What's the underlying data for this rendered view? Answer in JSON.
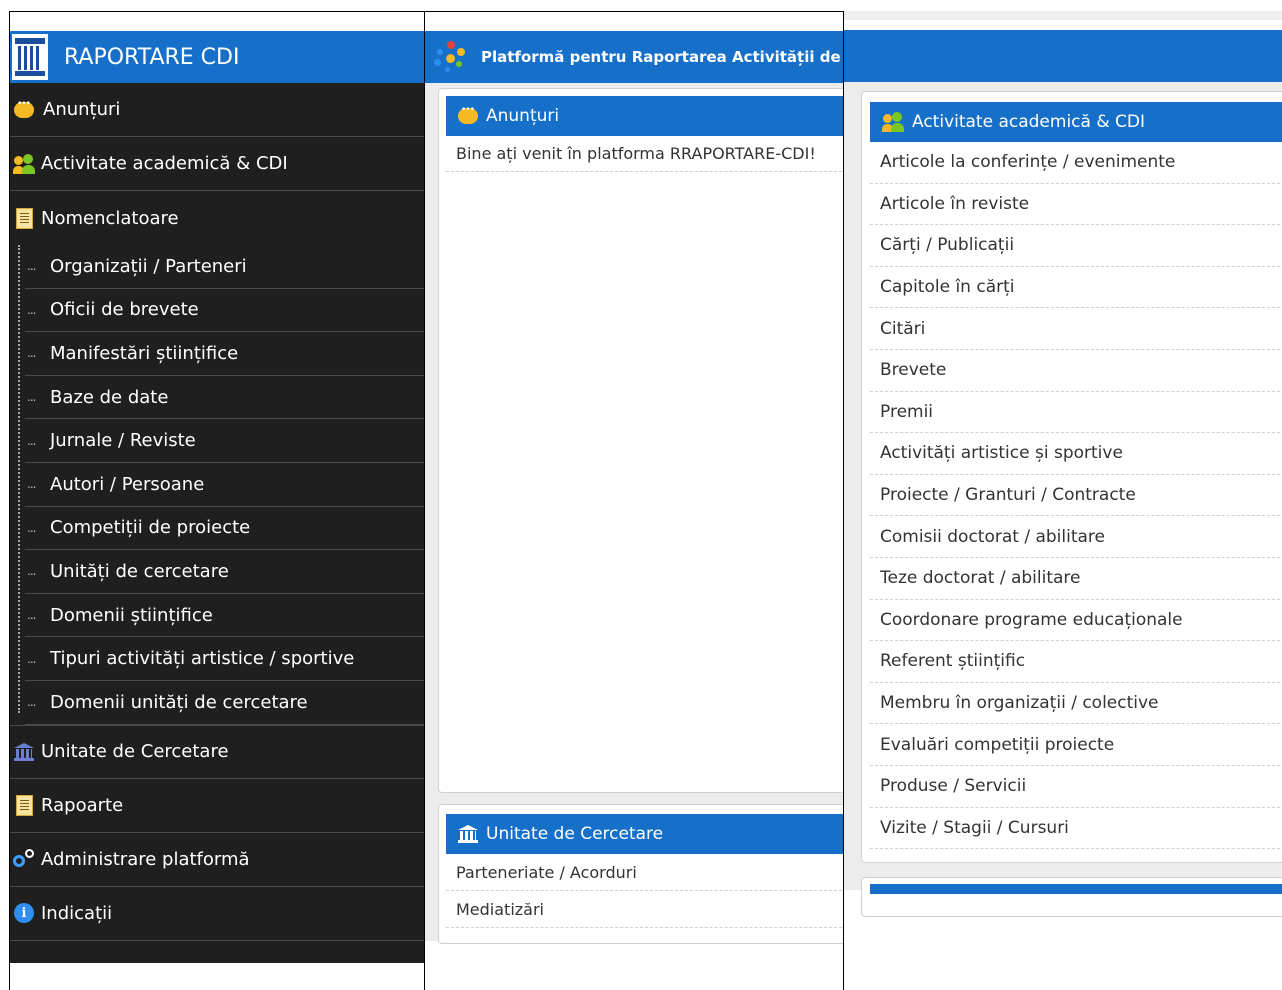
{
  "sidebar": {
    "brand": "RAPORTARE CDI",
    "items": [
      {
        "label": "Anunțuri"
      },
      {
        "label": "Activitate academică & CDI"
      },
      {
        "label": "Nomenclatoare"
      },
      {
        "label": "Unitate de Cercetare"
      },
      {
        "label": "Rapoarte"
      },
      {
        "label": "Administrare platformă"
      },
      {
        "label": "Indicații"
      }
    ],
    "nomenclatoare": [
      "Organizații / Parteneri",
      "Oficii de brevete",
      "Manifestări științifice",
      "Baze de date",
      "Jurnale / Reviste",
      "Autori / Persoane",
      "Competiții de proiecte",
      "Unități de cercetare",
      "Domenii științifice",
      "Tipuri activități artistice / sportive",
      "Domenii unități de cercetare"
    ],
    "dots": "..."
  },
  "header": {
    "title": "Platformă pentru Raportarea Activității de"
  },
  "anunturi": {
    "title": "Anunțuri",
    "message": "Bine ați venit în platforma RRAPORTARE-CDI!"
  },
  "unitate": {
    "title": "Unitate de Cercetare",
    "items": [
      "Parteneriate / Acorduri",
      "Mediatizări"
    ]
  },
  "activitate": {
    "title": "Activitate academică & CDI",
    "items": [
      "Articole la conferințe / evenimente",
      "Articole în reviste",
      "Cărți / Publicații",
      "Capitole în cărți",
      "Citări",
      "Brevete",
      "Premii",
      "Activități artistice și sportive",
      "Proiecte / Granturi / Contracte",
      "Comisii doctorat / abilitare",
      "Teze doctorat / abilitare",
      "Coordonare programe educaționale",
      "Referent științific",
      "Membru în organizații / colective",
      "Evaluări competiții proiecte",
      "Produse / Servicii",
      "Vizite / Stagii / Cursuri"
    ]
  },
  "colors": {
    "accent": "#1670c9",
    "sidebar_bg": "#1f1f1f",
    "content_bg": "#ececec"
  }
}
